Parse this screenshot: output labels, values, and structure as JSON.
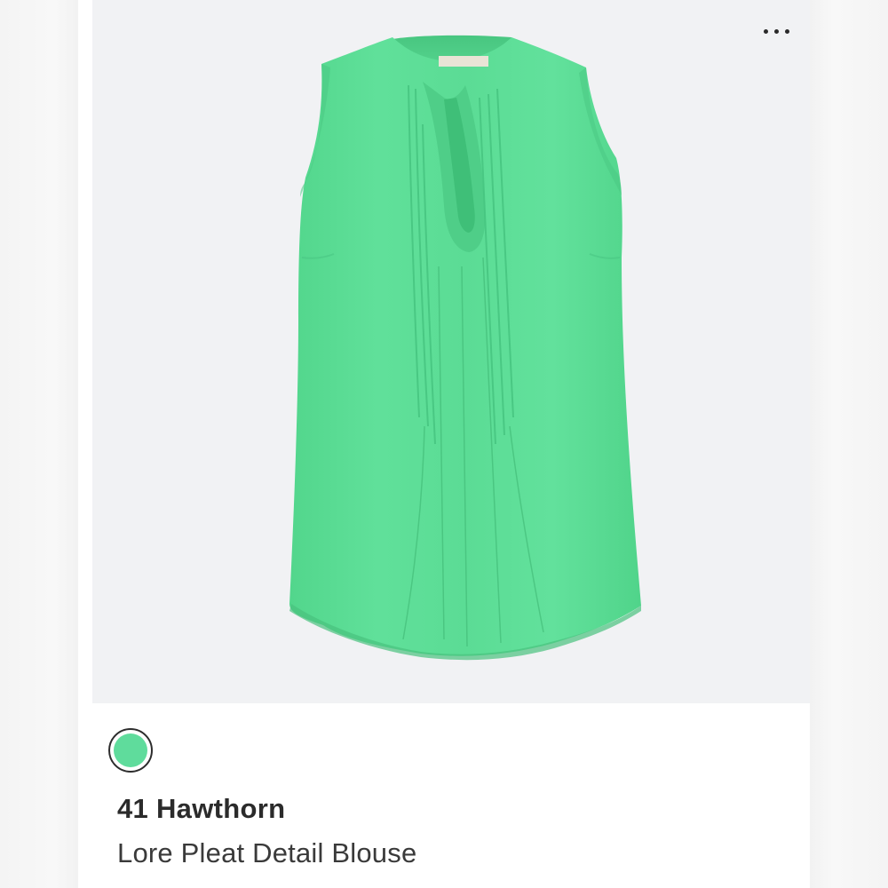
{
  "product": {
    "brand": "41 Hawthorn",
    "name": "Lore Pleat Detail Blouse",
    "image_icon": "sleeveless-green-blouse-image",
    "image_background": "#f1f2f4",
    "garment_color": "#5ddd96"
  },
  "menu": {
    "icon": "more-horizontal-icon"
  },
  "swatch": {
    "icon": "color-swatch-icon",
    "color": "#5fdc9c",
    "selected": true
  }
}
